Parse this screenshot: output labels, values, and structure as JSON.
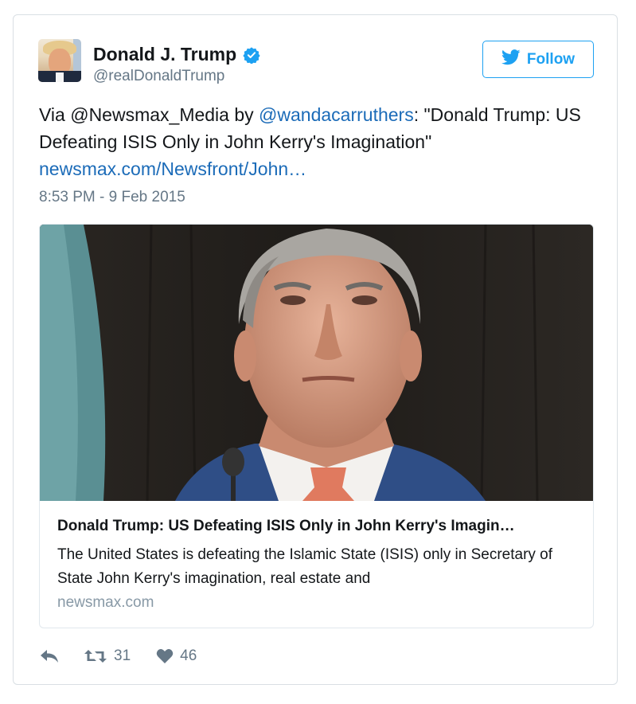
{
  "author": {
    "name": "Donald J. Trump",
    "handle": "@realDonaldTrump",
    "verified": true,
    "avatar_icon": "profile-photo"
  },
  "follow_button": {
    "label": "Follow",
    "icon": "twitter-bird-icon",
    "color": "#1da1f2"
  },
  "tweet": {
    "text_prefix": "Via @Newsmax_Media by ",
    "mention": "@wandacarruthers",
    "text_quote": ": \"Donald Trump: US Defeating ISIS Only in John Kerry's Imagination\"",
    "link": "newsmax.com/Newsfront/John…",
    "timestamp": "8:53 PM - 9 Feb 2015"
  },
  "card": {
    "image_description_icon": "photo",
    "title": "Donald Trump: US Defeating ISIS Only in John Kerry's Imagin…",
    "description": "The United States is defeating the Islamic State (ISIS) only in Secretary of State John Kerry's imagination, real estate and",
    "domain": "newsmax.com"
  },
  "actions": {
    "reply_icon": "reply-icon",
    "retweet_icon": "retweet-icon",
    "retweet_count": "31",
    "like_icon": "heart-icon",
    "like_count": "46"
  },
  "colors": {
    "link": "#1b6bb8",
    "muted": "#657786",
    "border": "#d9dfe4"
  }
}
